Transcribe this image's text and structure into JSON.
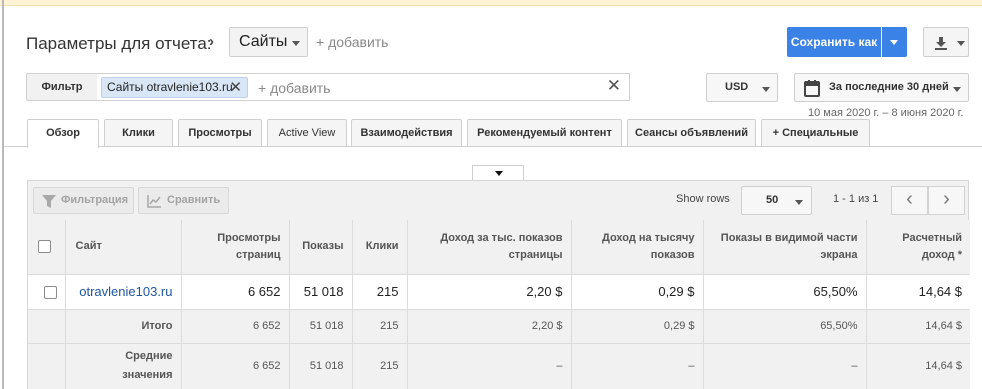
{
  "header": {
    "title": "Параметры для отчета:",
    "dimension": "Сайты",
    "add_dimension": "+ добавить",
    "save_label": "Сохранить как"
  },
  "filter": {
    "label": "Фильтр",
    "chip": "Сайты otravlenie103.ru",
    "add": "+ добавить"
  },
  "currency": "USD",
  "date": {
    "range_label": "За последние 30 дней",
    "sub": "10 мая 2020 г. – 8 июня 2020 г."
  },
  "tabs": [
    {
      "label": "Обзор"
    },
    {
      "label": "Клики"
    },
    {
      "label": "Просмотры"
    },
    {
      "label": "Active View"
    },
    {
      "label": "Взаимодействия"
    },
    {
      "label": "Рекомендуемый контент"
    },
    {
      "label": "Сеансы объявлений"
    },
    {
      "label": "+ Специальные"
    }
  ],
  "toolbar": {
    "filter_label": "Фильтрация",
    "compare_label": "Сравнить",
    "show_rows_label": "Show rows",
    "rows_value": "50",
    "page_info": "1 - 1 из 1"
  },
  "table": {
    "columns": [
      "Сайт",
      "Просмотры страниц",
      "Показы",
      "Клики",
      "Доход за тыс. показов страницы",
      "Доход на тысячу показов",
      "Показы в видимой части экрана",
      "Расчетный доход *"
    ],
    "site_row": [
      "otravlenie103.ru",
      "6 652",
      "51 018",
      "215",
      "2,20 $",
      "0,29 $",
      "65,50%",
      "14,64 $"
    ],
    "total_row": [
      "Итого",
      "6 652",
      "51 018",
      "215",
      "2,20 $",
      "0,29 $",
      "65,50%",
      "14,64 $"
    ],
    "avg_row": [
      "Средние значения",
      "6 652",
      "51 018",
      "215",
      "–",
      "–",
      "–",
      "14,64 $"
    ]
  }
}
